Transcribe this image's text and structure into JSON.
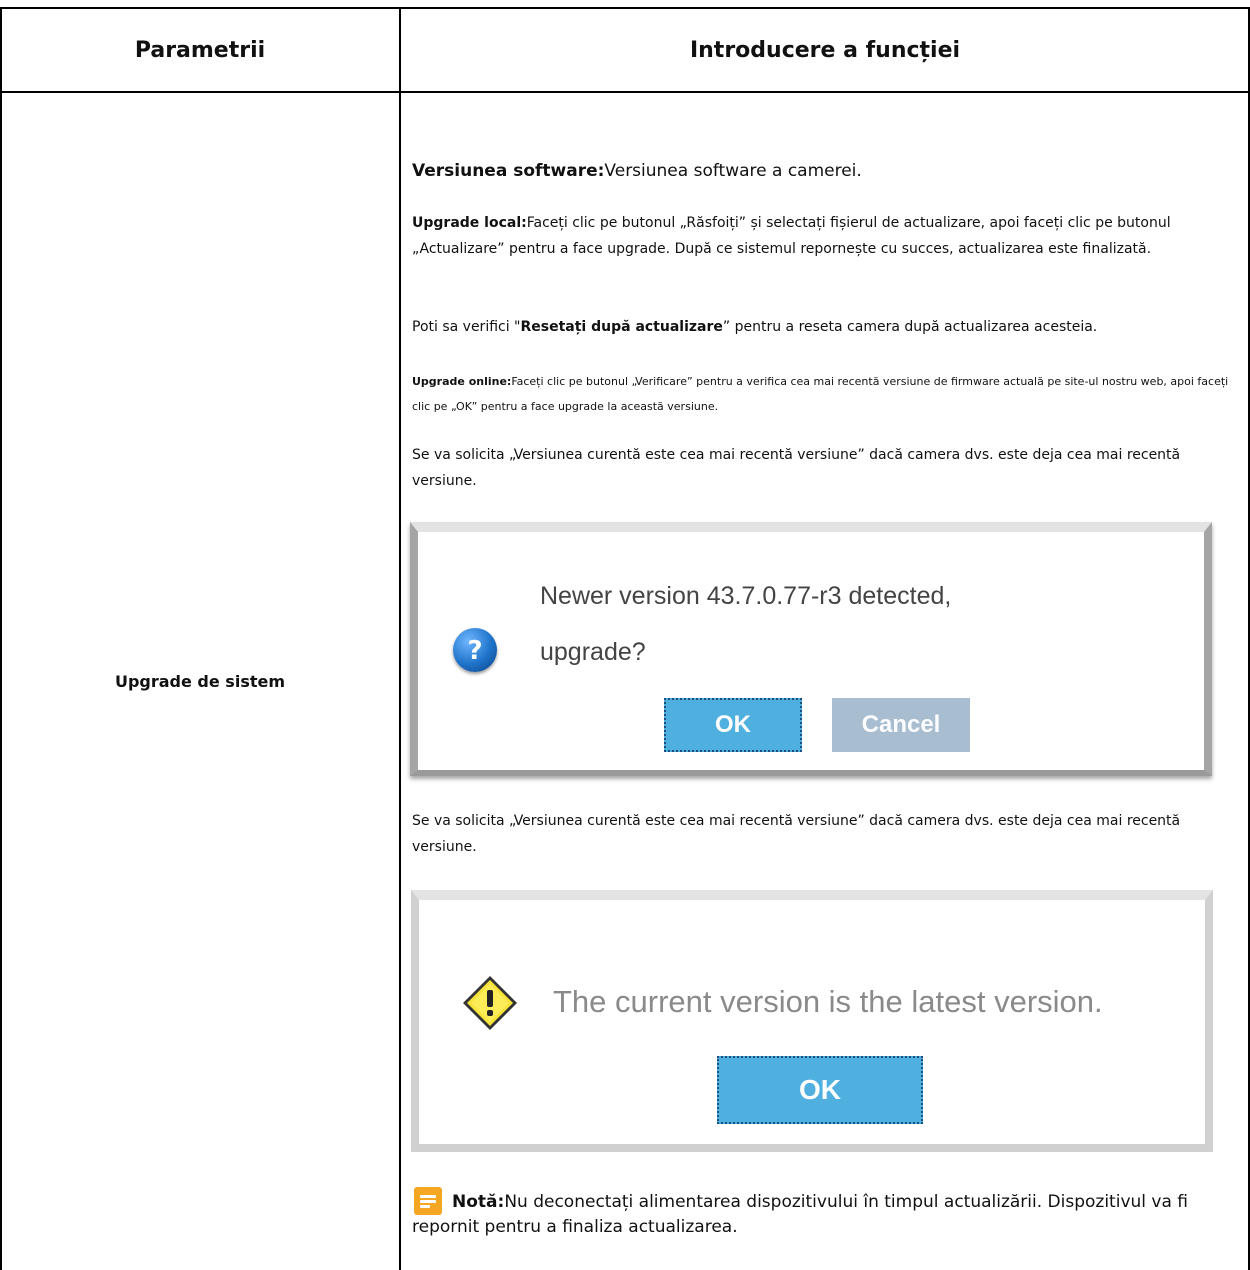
{
  "table": {
    "header_param": "Parametrii",
    "header_desc": "Introducere a funcției",
    "param_name": "Upgrade de sistem"
  },
  "content": {
    "p1_bold": "Versiunea software:",
    "p1_text": "Versiunea software a camerei.",
    "p2_bold": "Upgrade local:",
    "p2_text": "Faceți clic pe butonul „Răsfoiți” și selectați fișierul de actualizare, apoi faceți clic pe butonul „Actualizare” pentru a face upgrade. După ce sistemul repornește cu succes, actualizarea este finalizată.",
    "p3_pre": "Poti sa verifici \"",
    "p3_bold": "Resetați după actualizare",
    "p3_post": "” pentru a reseta camera după actualizarea acesteia.",
    "p4_bold": "Upgrade online:",
    "p4_text": "Faceți clic pe butonul „Verificare” pentru a verifica cea mai recentă versiune de firmware actuală pe site-ul nostru web, apoi faceți clic pe „OK” pentru a face upgrade la această versiune.",
    "p5_text": "Se va solicita „Versiunea curentă este cea mai recentă versiune” dacă camera dvs. este deja cea mai recentă versiune.",
    "p6_text": "Se va solicita „Versiunea curentă este cea mai recentă versiune” dacă camera dvs. este deja cea mai recentă versiune.",
    "note_bold": "Notă:",
    "note_text": "Nu deconectați alimentarea dispozitivului în timpul actualizării. Dispozitivul va fi repornit pentru a finaliza actualizarea."
  },
  "dialog_upgrade": {
    "line1": "Newer version 43.7.0.77-r3 detected,",
    "line2": "upgrade?",
    "ok_label": "OK",
    "cancel_label": "Cancel",
    "icon": "question-icon"
  },
  "dialog_latest": {
    "message": "The current version is the latest version.",
    "ok_label": "OK",
    "icon": "warning-icon"
  },
  "colors": {
    "ok_button": "#4fb0e0",
    "cancel_button": "#a8bdd0",
    "note_icon": "#f5a623"
  }
}
